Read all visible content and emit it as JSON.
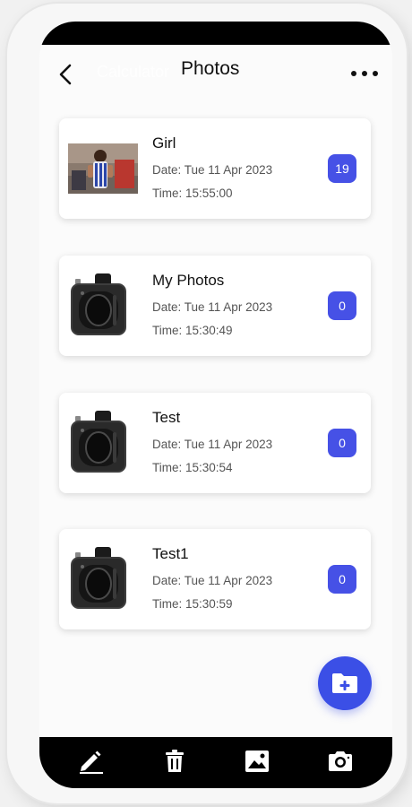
{
  "appbar": {
    "ghost_text": "Calculator",
    "title": "Photos"
  },
  "albums": [
    {
      "name": "Girl",
      "date": "Date: Tue 11 Apr 2023",
      "time": "Time: 15:55:00",
      "count": "19",
      "thumbnail": "photo-thumbnail"
    },
    {
      "name": "My Photos",
      "date": "Date: Tue 11 Apr 2023",
      "time": "Time: 15:30:49",
      "count": "0",
      "thumbnail": "camera-icon"
    },
    {
      "name": "Test",
      "date": "Date: Tue 11 Apr 2023",
      "time": "Time: 15:30:54",
      "count": "0",
      "thumbnail": "camera-icon"
    },
    {
      "name": "Test1",
      "date": "Date: Tue 11 Apr 2023",
      "time": "Time: 15:30:59",
      "count": "0",
      "thumbnail": "camera-icon"
    }
  ],
  "fab": {
    "icon": "folder-add-icon"
  },
  "toolbar": {
    "icons": [
      "pencil-icon",
      "trash-icon",
      "image-icon",
      "camera-icon"
    ]
  },
  "colors": {
    "accent": "#4651e6",
    "fab": "#3b4fe6",
    "bar": "#000000"
  }
}
